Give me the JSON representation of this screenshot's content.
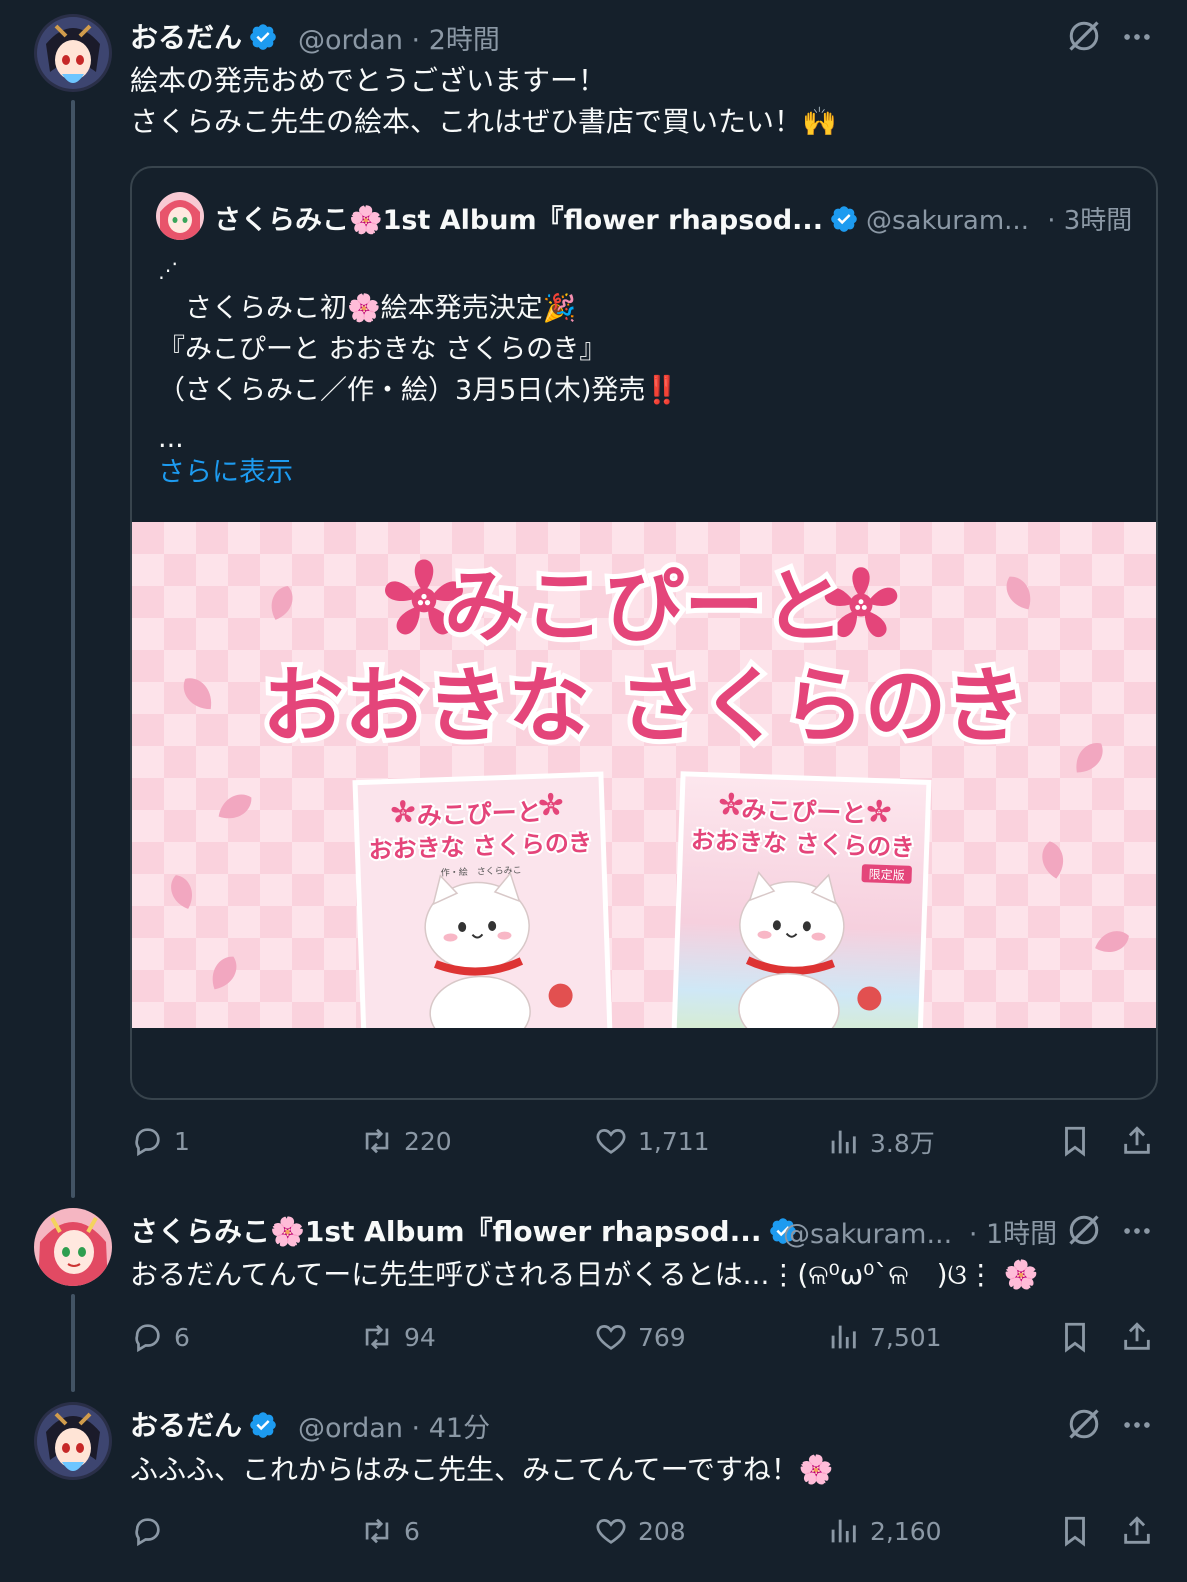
{
  "posts": [
    {
      "display_name": "おるだん",
      "handle": "@ordan",
      "time": "· 2時間",
      "lines": [
        "絵本の発売おめでとうございますー！",
        "さくらみこ先生の絵本、これはぜひ書店で買いたい！🙌"
      ],
      "actions": {
        "replies": "1",
        "reposts": "220",
        "likes": "1,711",
        "views": "3.8万"
      }
    },
    {
      "display_name": "さくらみこ🌸1st Album『flower rhapsod...",
      "handle": "@sakuram...",
      "time": "· 1時間",
      "lines": [
        "おるだんてんてーに先生呼びされる日がくるとは...⋮(ଳ⁰ω⁰`ଳ　)ଓ⋮ 🌸"
      ],
      "actions": {
        "replies": "6",
        "reposts": "94",
        "likes": "769",
        "views": "7,501"
      }
    },
    {
      "display_name": "おるだん",
      "handle": "@ordan",
      "time": "· 41分",
      "lines": [
        "ふふふ、これからはみこ先生、みこてんてーですね！🌸"
      ],
      "actions": {
        "replies": "",
        "reposts": "6",
        "likes": "208",
        "views": "2,160"
      }
    }
  ],
  "quote": {
    "display_name": "さくらみこ🌸1st Album『flower rhapsod...",
    "handle": "@sakuram...",
    "time": "· 3時間",
    "lines": [
      "⋰",
      "　さくらみこ初🌸絵本発売決定🎉",
      "『みこぴーと おおきな さくらのき』",
      "（さくらみこ／作・絵）3月5日(木)発売‼️",
      "..."
    ],
    "show_more": "さらに表示",
    "image": {
      "title_line1": "みこぴーと",
      "title_line2": "おおきな さくらのき",
      "book_left_title1": "みこぴーと",
      "book_left_title2": "おおきな さくらのき",
      "book_left_author": "作・絵　さくらみこ",
      "book_right_title1": "みこぴーと",
      "book_right_title2": "おおきな さくらのき",
      "book_right_badge": "限定版"
    }
  },
  "colors": {
    "background": "#15202b",
    "text": "#f7f9f9",
    "muted": "#8b98a5",
    "accent": "#1d9bf0",
    "border": "#38444d"
  },
  "icons": [
    "verified-badge-icon",
    "grok-icon",
    "more-icon",
    "reply-icon",
    "repost-icon",
    "like-icon",
    "views-icon",
    "bookmark-icon",
    "share-icon"
  ]
}
